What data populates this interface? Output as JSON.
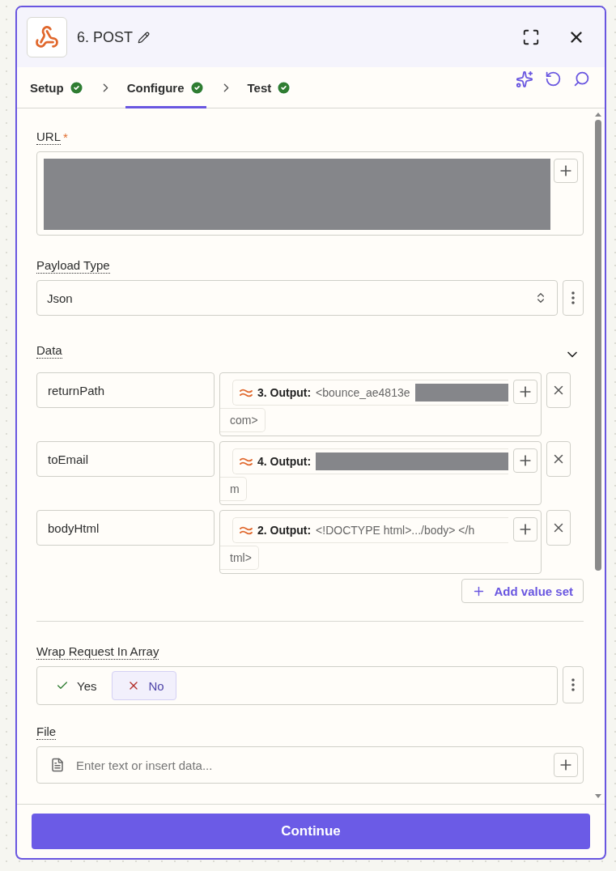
{
  "header": {
    "title": "6. POST"
  },
  "tabs": [
    {
      "label": "Setup",
      "selected": false,
      "complete": true
    },
    {
      "label": "Configure",
      "selected": true,
      "complete": true
    },
    {
      "label": "Test",
      "selected": false,
      "complete": true
    }
  ],
  "url": {
    "label": "URL",
    "required_mark": "*"
  },
  "payload_type": {
    "label": "Payload Type",
    "value": "Json"
  },
  "data": {
    "label": "Data",
    "expanded": true,
    "rows": [
      {
        "key": "returnPath",
        "pill_label": "3. Output:",
        "pill_value": "<bounce_ae4813e",
        "redacted": true,
        "continuation": "com>"
      },
      {
        "key": "toEmail",
        "pill_label": "4. Output:",
        "redacted": true,
        "continuation": "m"
      },
      {
        "key": "bodyHtml",
        "pill_label": "2. Output:",
        "pill_value": "<!DOCTYPE html>.../body>  </h",
        "redacted": false,
        "continuation": "tml>"
      }
    ],
    "add_label": "Add value set"
  },
  "wrap_request": {
    "label": "Wrap Request In Array",
    "options": [
      {
        "label": "Yes",
        "kind": "check",
        "selected": false
      },
      {
        "label": "No",
        "kind": "cross",
        "selected": true
      }
    ]
  },
  "file": {
    "label": "File",
    "placeholder": "Enter text or insert data..."
  },
  "continue_button": "Continue"
}
